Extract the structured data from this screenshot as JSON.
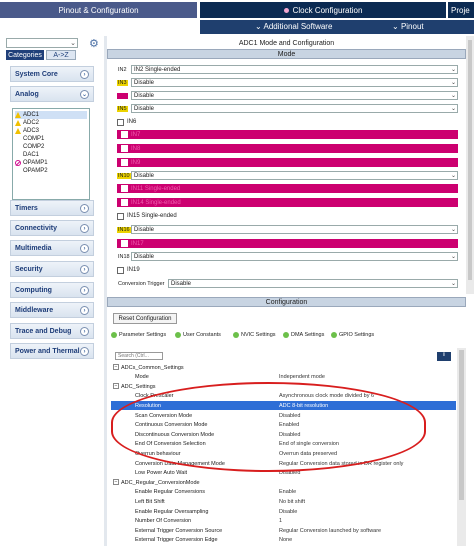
{
  "tabs": {
    "pinout_config": "Pinout & Configuration",
    "clock_config": "Clock Configuration",
    "project": "Proje"
  },
  "subbar": {
    "additional_software": "Additional Software",
    "pinout": "Pinout"
  },
  "sidebar": {
    "search_placeholder": "",
    "tab_categories": "Categories",
    "tab_az": "A->Z",
    "categories": [
      "System Core",
      "Analog",
      "Timers",
      "Connectivity",
      "Multimedia",
      "Security",
      "Computing",
      "Middleware",
      "Trace and Debug",
      "Power and Thermal"
    ],
    "analog_items": [
      {
        "label": "ADC1",
        "status": "warning",
        "selected": true
      },
      {
        "label": "ADC2",
        "status": "warning"
      },
      {
        "label": "ADC3",
        "status": "warning"
      },
      {
        "label": "COMP1",
        "status": "none"
      },
      {
        "label": "COMP2",
        "status": "none"
      },
      {
        "label": "DAC1",
        "status": "none"
      },
      {
        "label": "OPAMP1",
        "status": "forbidden"
      },
      {
        "label": "OPAMP2",
        "status": "none"
      }
    ]
  },
  "main": {
    "title": "ADC1 Mode and Configuration",
    "mode_header": "Mode",
    "mode_rows": [
      {
        "pin": "IN2",
        "value": "IN2 Single-ended",
        "style": "plain",
        "kind": "select"
      },
      {
        "pin": "IN3",
        "value": "Disable",
        "style": "yellow",
        "kind": "select"
      },
      {
        "pin": "IN4",
        "value": "Disable",
        "style": "magenta",
        "kind": "select"
      },
      {
        "pin": "IN5",
        "value": "Disable",
        "style": "yellow",
        "kind": "select"
      },
      {
        "pin": "IN6",
        "value": "",
        "style": "plain",
        "kind": "check"
      },
      {
        "pin": "IN7",
        "value": "",
        "style": "magenta",
        "kind": "bar"
      },
      {
        "pin": "IN8",
        "value": "",
        "style": "magenta",
        "kind": "bar"
      },
      {
        "pin": "IN9",
        "value": "",
        "style": "magenta",
        "kind": "bar"
      },
      {
        "pin": "IN10",
        "value": "Disable",
        "style": "yellow",
        "kind": "select"
      },
      {
        "pin": "IN11 Single-ended",
        "value": "",
        "style": "magenta",
        "kind": "bar"
      },
      {
        "pin": "IN14 Single-ended",
        "value": "",
        "style": "magenta",
        "kind": "bar"
      },
      {
        "pin": "IN15 Single-ended",
        "value": "",
        "style": "plain",
        "kind": "check"
      },
      {
        "pin": "IN16",
        "value": "Disable",
        "style": "yellow",
        "kind": "select"
      },
      {
        "pin": "IN17",
        "value": "",
        "style": "magenta",
        "kind": "bar"
      },
      {
        "pin": "IN18",
        "value": "Disable",
        "style": "plain",
        "kind": "select"
      },
      {
        "pin": "IN19",
        "value": "",
        "style": "plain",
        "kind": "check"
      }
    ],
    "conversion_trigger_label": "Conversion Trigger",
    "conversion_trigger_value": "Disable",
    "config_header": "Configuration",
    "reset_button": "Reset Configuration",
    "settings_tabs": [
      "Parameter Settings",
      "User Constants",
      "NVIC Settings",
      "DMA Settings",
      "GPIO Settings"
    ],
    "search_placeholder": "Search (Ctrl...",
    "params": [
      {
        "key": "ADCs_Common_Settings",
        "value": "",
        "group": true
      },
      {
        "key": "Mode",
        "value": "Independent mode"
      },
      {
        "key": "ADC_Settings",
        "value": "",
        "group": true
      },
      {
        "key": "Clock Prescaler",
        "value": "Asynchronous clock mode divided by 6"
      },
      {
        "key": "Resolution",
        "value": "ADC 8-bit resolution",
        "selected": true
      },
      {
        "key": "Scan Conversion Mode",
        "value": "Disabled"
      },
      {
        "key": "Continuous Conversion Mode",
        "value": "Enabled"
      },
      {
        "key": "Discontinuous Conversion Mode",
        "value": "Disabled"
      },
      {
        "key": "End Of Conversion Selection",
        "value": "End of single conversion"
      },
      {
        "key": "Overrun behaviour",
        "value": "Overrun data preserved"
      },
      {
        "key": "Conversion Data Management Mode",
        "value": "Regular Conversion data stored in DR register only"
      },
      {
        "key": "Low Power Auto Wait",
        "value": "Disabled"
      },
      {
        "key": "ADC_Regular_ConversionMode",
        "value": "",
        "group": true
      },
      {
        "key": "Enable Regular Conversions",
        "value": "Enable"
      },
      {
        "key": "Left Bit Shift",
        "value": "No bit shift"
      },
      {
        "key": "Enable Regular Oversampling",
        "value": "Disable"
      },
      {
        "key": "Number Of Conversion",
        "value": "1"
      },
      {
        "key": "External Trigger Conversion Source",
        "value": "Regular Conversion launched by software"
      },
      {
        "key": "External Trigger Conversion Edge",
        "value": "None"
      }
    ]
  }
}
